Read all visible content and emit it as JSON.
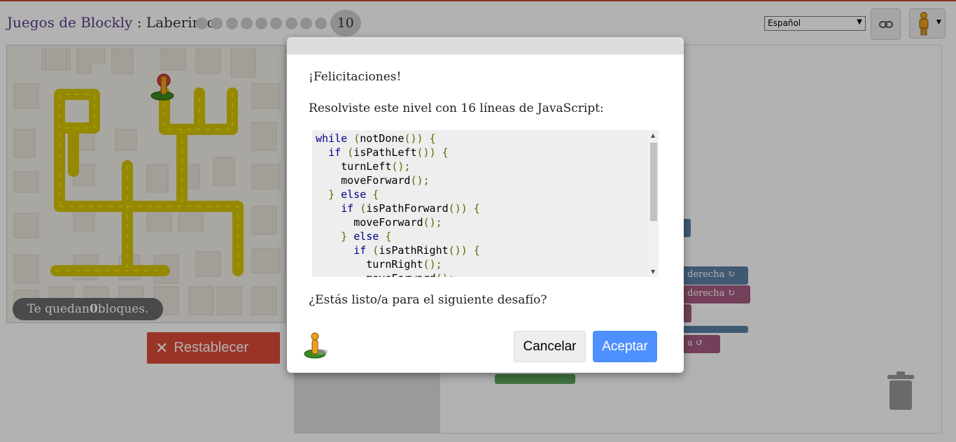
{
  "header": {
    "app_name": "Juegos de Blockly",
    "separator": " : ",
    "page_name": "Laberinto",
    "level_dots": 9,
    "current_level": "10"
  },
  "language": {
    "selected": "Español"
  },
  "maze": {
    "blocks_remaining_prefix": "Te quedan ",
    "blocks_remaining_count": "0",
    "blocks_remaining_suffix": " bloques."
  },
  "controls": {
    "reset_label": "Restablecer"
  },
  "workspace": {
    "block_labels": [
      "derecha ↻",
      "derecha ↻",
      "a ↺"
    ]
  },
  "dialog": {
    "congrats": "¡Felicitaciones!",
    "summary": "Resolviste este nivel con 16 líneas de JavaScript:",
    "question": "¿Estás listo/a para el siguiente desafío?",
    "cancel_label": "Cancelar",
    "ok_label": "Aceptar",
    "code_lines": [
      "while (notDone()) {",
      "  if (isPathLeft()) {",
      "    turnLeft();",
      "    moveForward();",
      "  } else {",
      "    if (isPathForward()) {",
      "      moveForward();",
      "    } else {",
      "      if (isPathRight()) {",
      "        turnRight();",
      "        moveForward();"
    ]
  },
  "colors": {
    "reset_button": "#dd4b39",
    "ok_button": "#4d90fe",
    "path": "#d4c400",
    "title_app": "#5b3c88"
  },
  "icons": {
    "link": "link-icon",
    "avatar": "pegman-icon",
    "trash": "trash-icon",
    "reset": "x-icon"
  }
}
